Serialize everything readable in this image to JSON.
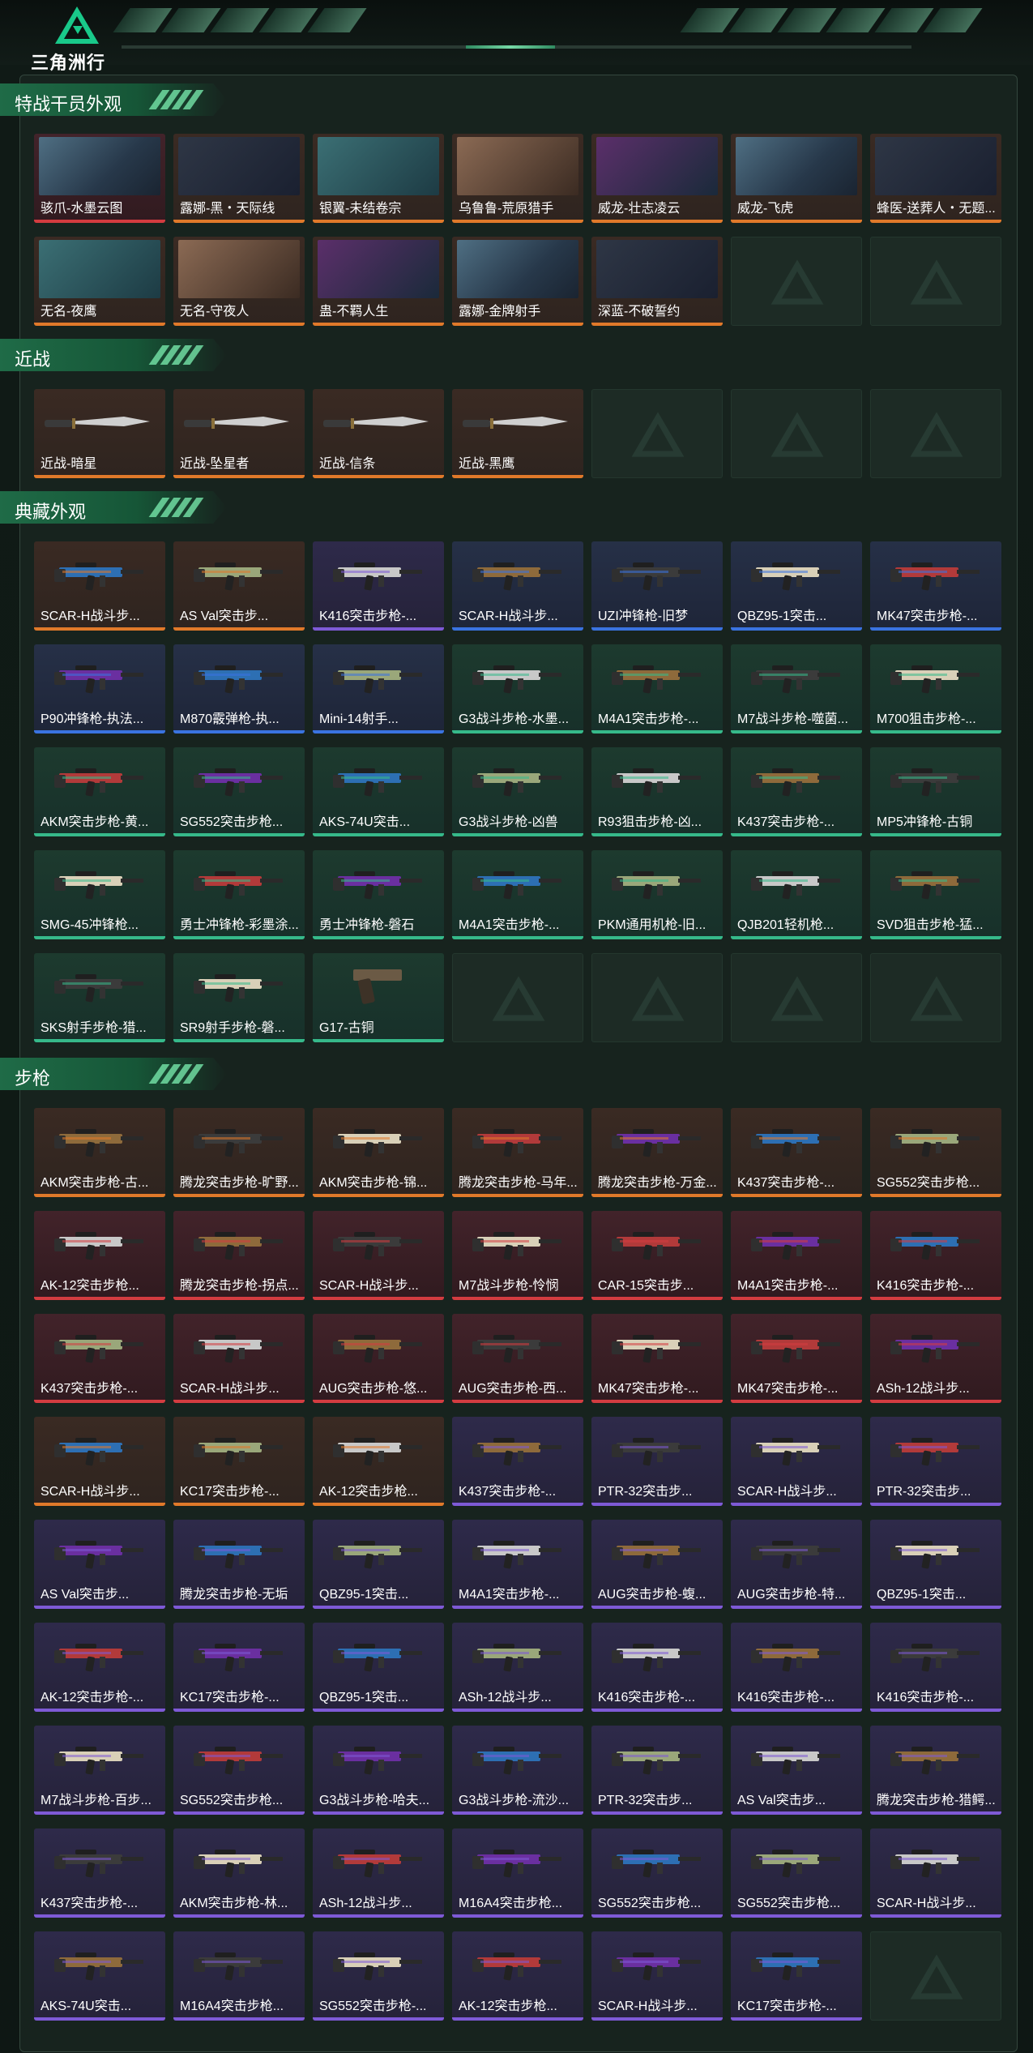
{
  "header": {
    "title": "三角洲行动"
  },
  "sections": [
    {
      "key": "operator",
      "title": "特战干员外观",
      "items": [
        {
          "label": "骇爪-水墨云图",
          "rarity": "red",
          "kind": "portrait"
        },
        {
          "label": "露娜-黑・天际线",
          "rarity": "orange",
          "kind": "portrait"
        },
        {
          "label": "银翼-未结卷宗",
          "rarity": "orange",
          "kind": "portrait"
        },
        {
          "label": "乌鲁鲁-荒原猎手",
          "rarity": "orange",
          "kind": "portrait"
        },
        {
          "label": "威龙-壮志凌云",
          "rarity": "orange",
          "kind": "portrait"
        },
        {
          "label": "威龙-飞虎",
          "rarity": "orange",
          "kind": "portrait"
        },
        {
          "label": "蜂医-送葬人・无题...",
          "rarity": "orange",
          "kind": "portrait"
        },
        {
          "label": "无名-夜鹰",
          "rarity": "orange",
          "kind": "portrait"
        },
        {
          "label": "无名-守夜人",
          "rarity": "orange",
          "kind": "portrait"
        },
        {
          "label": "蛊-不羁人生",
          "rarity": "orange",
          "kind": "portrait"
        },
        {
          "label": "露娜-金牌射手",
          "rarity": "orange",
          "kind": "portrait"
        },
        {
          "label": "深蓝-不破誓约",
          "rarity": "orange",
          "kind": "portrait"
        },
        {
          "label": "",
          "rarity": "empty",
          "kind": "empty"
        },
        {
          "label": "",
          "rarity": "empty",
          "kind": "empty"
        }
      ]
    },
    {
      "key": "melee",
      "title": "近战",
      "items": [
        {
          "label": "近战-暗星",
          "rarity": "orange",
          "kind": "knife"
        },
        {
          "label": "近战-坠星者",
          "rarity": "orange",
          "kind": "knife"
        },
        {
          "label": "近战-信条",
          "rarity": "orange",
          "kind": "knife"
        },
        {
          "label": "近战-黑鹰",
          "rarity": "orange",
          "kind": "knife"
        },
        {
          "label": "",
          "rarity": "empty",
          "kind": "empty"
        },
        {
          "label": "",
          "rarity": "empty",
          "kind": "empty"
        },
        {
          "label": "",
          "rarity": "empty",
          "kind": "empty"
        }
      ]
    },
    {
      "key": "collection",
      "title": "典藏外观",
      "items": [
        {
          "label": "SCAR-H战斗步...",
          "rarity": "orange",
          "kind": "gun"
        },
        {
          "label": "AS Val突击步...",
          "rarity": "orange",
          "kind": "gun"
        },
        {
          "label": "K416突击步枪-...",
          "rarity": "purple",
          "kind": "gun"
        },
        {
          "label": "SCAR-H战斗步...",
          "rarity": "blue",
          "kind": "gun"
        },
        {
          "label": "UZI冲锋枪-旧梦",
          "rarity": "blue",
          "kind": "gun"
        },
        {
          "label": "QBZ95-1突击...",
          "rarity": "blue",
          "kind": "gun"
        },
        {
          "label": "MK47突击步枪-...",
          "rarity": "blue",
          "kind": "gun"
        },
        {
          "label": "P90冲锋枪-执法...",
          "rarity": "blue",
          "kind": "gun"
        },
        {
          "label": "M870霰弹枪-执...",
          "rarity": "blue",
          "kind": "gun"
        },
        {
          "label": "Mini-14射手...",
          "rarity": "blue",
          "kind": "gun"
        },
        {
          "label": "G3战斗步枪-水墨...",
          "rarity": "green",
          "kind": "gun"
        },
        {
          "label": "M4A1突击步枪-...",
          "rarity": "green",
          "kind": "gun"
        },
        {
          "label": "M7战斗步枪-噬菌...",
          "rarity": "green",
          "kind": "gun"
        },
        {
          "label": "M700狙击步枪-...",
          "rarity": "green",
          "kind": "gun"
        },
        {
          "label": "AKM突击步枪-黄...",
          "rarity": "green",
          "kind": "gun"
        },
        {
          "label": "SG552突击步枪...",
          "rarity": "green",
          "kind": "gun"
        },
        {
          "label": "AKS-74U突击...",
          "rarity": "green",
          "kind": "gun"
        },
        {
          "label": "G3战斗步枪-凶兽",
          "rarity": "green",
          "kind": "gun"
        },
        {
          "label": "R93狙击步枪-凶...",
          "rarity": "green",
          "kind": "gun"
        },
        {
          "label": "K437突击步枪-...",
          "rarity": "green",
          "kind": "gun"
        },
        {
          "label": "MP5冲锋枪-古铜",
          "rarity": "green",
          "kind": "gun"
        },
        {
          "label": "SMG-45冲锋枪...",
          "rarity": "green",
          "kind": "gun"
        },
        {
          "label": "勇士冲锋枪-彩墨涂...",
          "rarity": "green",
          "kind": "gun"
        },
        {
          "label": "勇士冲锋枪-磐石",
          "rarity": "green",
          "kind": "gun"
        },
        {
          "label": "M4A1突击步枪-...",
          "rarity": "green",
          "kind": "gun"
        },
        {
          "label": "PKM通用机枪-旧...",
          "rarity": "green",
          "kind": "gun"
        },
        {
          "label": "QJB201轻机枪...",
          "rarity": "green",
          "kind": "gun"
        },
        {
          "label": "SVD狙击步枪-猛...",
          "rarity": "green",
          "kind": "gun"
        },
        {
          "label": "SKS射手步枪-猎...",
          "rarity": "green",
          "kind": "gun"
        },
        {
          "label": "SR9射手步枪-磐...",
          "rarity": "green",
          "kind": "gun"
        },
        {
          "label": "G17-古铜",
          "rarity": "green",
          "kind": "pistol"
        },
        {
          "label": "",
          "rarity": "empty",
          "kind": "empty"
        },
        {
          "label": "",
          "rarity": "empty",
          "kind": "empty"
        },
        {
          "label": "",
          "rarity": "empty",
          "kind": "empty"
        },
        {
          "label": "",
          "rarity": "empty",
          "kind": "empty"
        }
      ]
    },
    {
      "key": "rifle",
      "title": "步枪",
      "items": [
        {
          "label": "AKM突击步枪-古...",
          "rarity": "orange",
          "kind": "gun"
        },
        {
          "label": "腾龙突击步枪-旷野...",
          "rarity": "orange",
          "kind": "gun"
        },
        {
          "label": "AKM突击步枪-锦...",
          "rarity": "orange",
          "kind": "gun"
        },
        {
          "label": "腾龙突击步枪-马年...",
          "rarity": "orange",
          "kind": "gun"
        },
        {
          "label": "腾龙突击步枪-万金...",
          "rarity": "orange",
          "kind": "gun"
        },
        {
          "label": "K437突击步枪-...",
          "rarity": "orange",
          "kind": "gun"
        },
        {
          "label": "SG552突击步枪...",
          "rarity": "orange",
          "kind": "gun"
        },
        {
          "label": "AK-12突击步枪...",
          "rarity": "red",
          "kind": "gun"
        },
        {
          "label": "腾龙突击步枪-拐点...",
          "rarity": "red",
          "kind": "gun"
        },
        {
          "label": "SCAR-H战斗步...",
          "rarity": "red",
          "kind": "gun"
        },
        {
          "label": "M7战斗步枪-怜悯",
          "rarity": "red",
          "kind": "gun"
        },
        {
          "label": "CAR-15突击步...",
          "rarity": "red",
          "kind": "gun"
        },
        {
          "label": "M4A1突击步枪-...",
          "rarity": "red",
          "kind": "gun"
        },
        {
          "label": "K416突击步枪-...",
          "rarity": "red",
          "kind": "gun"
        },
        {
          "label": "K437突击步枪-...",
          "rarity": "red",
          "kind": "gun"
        },
        {
          "label": "SCAR-H战斗步...",
          "rarity": "red",
          "kind": "gun"
        },
        {
          "label": "AUG突击步枪-悠...",
          "rarity": "red",
          "kind": "gun"
        },
        {
          "label": "AUG突击步枪-西...",
          "rarity": "red",
          "kind": "gun"
        },
        {
          "label": "MK47突击步枪-...",
          "rarity": "red",
          "kind": "gun"
        },
        {
          "label": "MK47突击步枪-...",
          "rarity": "red",
          "kind": "gun"
        },
        {
          "label": "ASh-12战斗步...",
          "rarity": "red",
          "kind": "gun"
        },
        {
          "label": "SCAR-H战斗步...",
          "rarity": "orange",
          "kind": "gun"
        },
        {
          "label": "KC17突击步枪-...",
          "rarity": "orange",
          "kind": "gun"
        },
        {
          "label": "AK-12突击步枪...",
          "rarity": "orange",
          "kind": "gun"
        },
        {
          "label": "K437突击步枪-...",
          "rarity": "purple",
          "kind": "gun"
        },
        {
          "label": "PTR-32突击步...",
          "rarity": "purple",
          "kind": "gun"
        },
        {
          "label": "SCAR-H战斗步...",
          "rarity": "purple",
          "kind": "gun"
        },
        {
          "label": "PTR-32突击步...",
          "rarity": "purple",
          "kind": "gun"
        },
        {
          "label": "AS Val突击步...",
          "rarity": "purple",
          "kind": "gun"
        },
        {
          "label": "腾龙突击步枪-无垢",
          "rarity": "purple",
          "kind": "gun"
        },
        {
          "label": "QBZ95-1突击...",
          "rarity": "purple",
          "kind": "gun"
        },
        {
          "label": "M4A1突击步枪-...",
          "rarity": "purple",
          "kind": "gun"
        },
        {
          "label": "AUG突击步枪-蝮...",
          "rarity": "purple",
          "kind": "gun"
        },
        {
          "label": "AUG突击步枪-特...",
          "rarity": "purple",
          "kind": "gun"
        },
        {
          "label": "QBZ95-1突击...",
          "rarity": "purple",
          "kind": "gun"
        },
        {
          "label": "AK-12突击步枪-...",
          "rarity": "purple",
          "kind": "gun"
        },
        {
          "label": "KC17突击步枪-...",
          "rarity": "purple",
          "kind": "gun"
        },
        {
          "label": "QBZ95-1突击...",
          "rarity": "purple",
          "kind": "gun"
        },
        {
          "label": "ASh-12战斗步...",
          "rarity": "purple",
          "kind": "gun"
        },
        {
          "label": "K416突击步枪-...",
          "rarity": "purple",
          "kind": "gun"
        },
        {
          "label": "K416突击步枪-...",
          "rarity": "purple",
          "kind": "gun"
        },
        {
          "label": "K416突击步枪-...",
          "rarity": "purple",
          "kind": "gun"
        },
        {
          "label": "M7战斗步枪-百步...",
          "rarity": "purple",
          "kind": "gun"
        },
        {
          "label": "SG552突击步枪...",
          "rarity": "purple",
          "kind": "gun"
        },
        {
          "label": "G3战斗步枪-哈夫...",
          "rarity": "purple",
          "kind": "gun"
        },
        {
          "label": "G3战斗步枪-流沙...",
          "rarity": "purple",
          "kind": "gun"
        },
        {
          "label": "PTR-32突击步...",
          "rarity": "purple",
          "kind": "gun"
        },
        {
          "label": "AS Val突击步...",
          "rarity": "purple",
          "kind": "gun"
        },
        {
          "label": "腾龙突击步枪-猎鳄...",
          "rarity": "purple",
          "kind": "gun"
        },
        {
          "label": "K437突击步枪-...",
          "rarity": "purple",
          "kind": "gun"
        },
        {
          "label": "AKM突击步枪-林...",
          "rarity": "purple",
          "kind": "gun"
        },
        {
          "label": "ASh-12战斗步...",
          "rarity": "purple",
          "kind": "gun"
        },
        {
          "label": "M16A4突击步枪...",
          "rarity": "purple",
          "kind": "gun"
        },
        {
          "label": "SG552突击步枪...",
          "rarity": "purple",
          "kind": "gun"
        },
        {
          "label": "SG552突击步枪...",
          "rarity": "purple",
          "kind": "gun"
        },
        {
          "label": "SCAR-H战斗步...",
          "rarity": "purple",
          "kind": "gun"
        },
        {
          "label": "AKS-74U突击...",
          "rarity": "purple",
          "kind": "gun"
        },
        {
          "label": "M16A4突击步枪...",
          "rarity": "purple",
          "kind": "gun"
        },
        {
          "label": "SG552突击步枪-...",
          "rarity": "purple",
          "kind": "gun"
        },
        {
          "label": "AK-12突击步枪...",
          "rarity": "purple",
          "kind": "gun"
        },
        {
          "label": "SCAR-H战斗步...",
          "rarity": "purple",
          "kind": "gun"
        },
        {
          "label": "KC17突击步枪-...",
          "rarity": "purple",
          "kind": "gun"
        },
        {
          "label": "",
          "rarity": "empty",
          "kind": "empty"
        }
      ]
    }
  ],
  "colors": {
    "orange": "#e0792a",
    "blue": "#3a73e0",
    "green": "#36b98a",
    "purple": "#7e5ad6",
    "red": "#d33c40"
  }
}
